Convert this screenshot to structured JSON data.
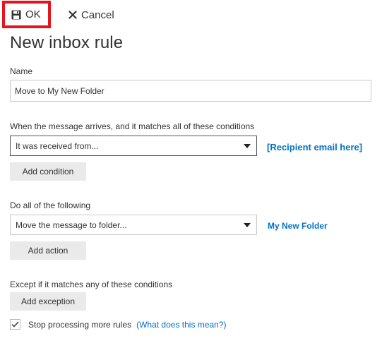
{
  "toolbar": {
    "ok_label": "OK",
    "cancel_label": "Cancel",
    "save_icon": "save-disk-icon",
    "cancel_icon": "close-x-icon",
    "highlight_color": "#e8141c"
  },
  "page": {
    "title": "New inbox rule"
  },
  "name_field": {
    "label": "Name",
    "value": "Move to My New Folder"
  },
  "conditions": {
    "label": "When the message arrives, and it matches all of these conditions",
    "selected": "It was received from...",
    "link_text": "[Recipient email here]",
    "add_button": "Add condition"
  },
  "actions": {
    "label": "Do all of the following",
    "selected": "Move the message to folder...",
    "link_text": "My New Folder",
    "add_button": "Add action"
  },
  "exceptions": {
    "label": "Except if it matches any of these conditions",
    "add_button": "Add exception"
  },
  "stop_processing": {
    "checked": true,
    "label": "Stop processing more rules",
    "open_paren": "(",
    "help_link": "What does this mean?",
    "close_paren": ")"
  },
  "colors": {
    "link": "#0072c6",
    "button_bg": "#eaeaea",
    "text": "#333333"
  }
}
